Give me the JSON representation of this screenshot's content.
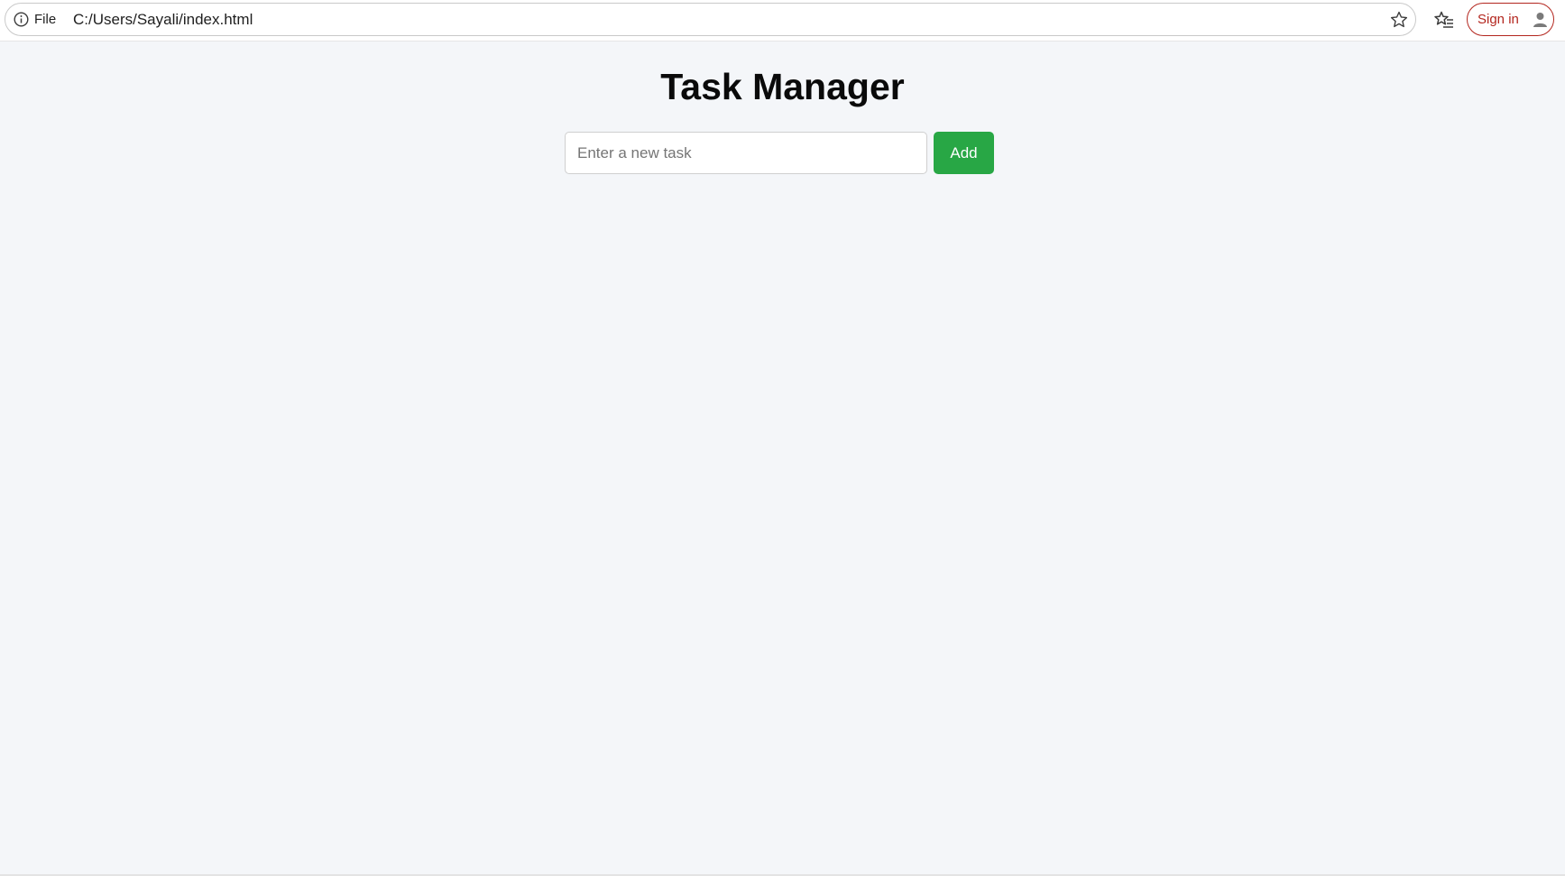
{
  "browser": {
    "site_info_label": "File",
    "url": "C:/Users/Sayali/index.html",
    "signin_label": "Sign in",
    "icons": {
      "site_info": "info-circle-icon",
      "bookmark": "star-outline-icon",
      "favorites": "favorites-list-icon",
      "avatar": "person-icon"
    },
    "signin_color": "#b3261e"
  },
  "app": {
    "title": "Task Manager",
    "task_input": {
      "value": "",
      "placeholder": "Enter a new task"
    },
    "add_label": "Add",
    "add_color": "#28a745",
    "tasks": []
  }
}
